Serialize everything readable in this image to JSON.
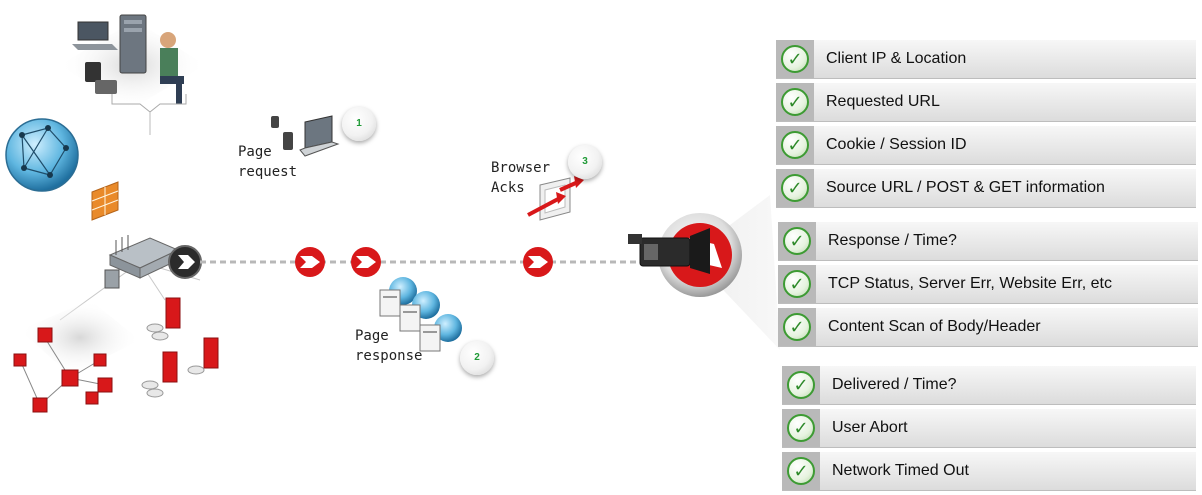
{
  "steps": [
    {
      "number": "1",
      "label_line1": "Page",
      "label_line2": "request"
    },
    {
      "number": "2",
      "label_line1": "Page",
      "label_line2": "response"
    },
    {
      "number": "3",
      "label_line1": "Browser",
      "label_line2": "Acks"
    }
  ],
  "checklist": {
    "groups": [
      {
        "items": [
          "Client IP & Location",
          "Requested URL",
          "Cookie / Session ID",
          "Source URL / POST & GET information"
        ]
      },
      {
        "items": [
          "Response / Time?",
          "TCP Status, Server Err, Website Err, etc",
          "Content Scan of Body/Header"
        ]
      },
      {
        "items": [
          "Delivered / Time?",
          "User Abort",
          "Network Timed Out"
        ]
      }
    ],
    "check_glyph": "✓",
    "check_color": "#3d9b33"
  },
  "colors": {
    "accent_red": "#d8181a",
    "arrow_dash": "#b8b8b8"
  }
}
